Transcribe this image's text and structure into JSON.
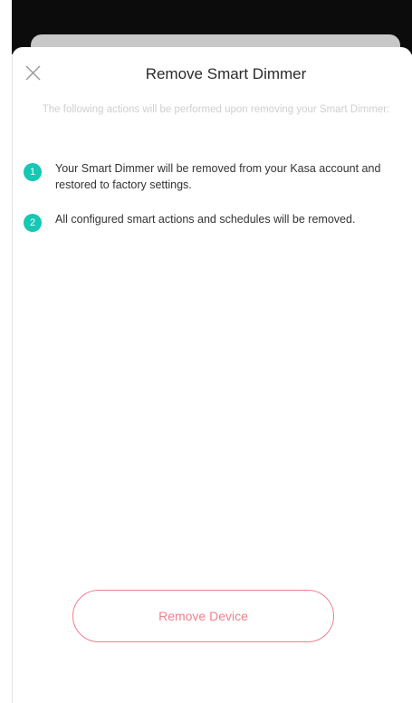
{
  "header": {
    "title": "Remove Smart Dimmer",
    "close_icon": "close-icon"
  },
  "subtitle": "The following actions will be performed upon removing your Smart Dimmer:",
  "steps": [
    {
      "number": "1",
      "text": "Your Smart Dimmer will be removed from your Kasa account and restored to factory settings."
    },
    {
      "number": "2",
      "text": "All configured smart actions and schedules will be removed."
    }
  ],
  "actions": {
    "remove_label": "Remove Device"
  },
  "colors": {
    "accent": "#16c7b3",
    "danger": "#f0808c",
    "overlay": "#0c0c0c"
  }
}
